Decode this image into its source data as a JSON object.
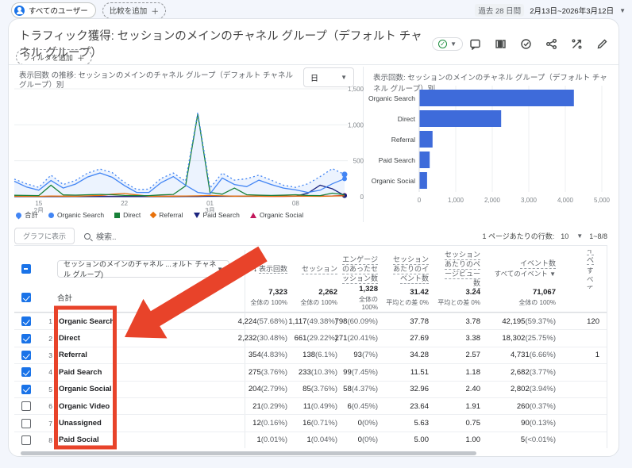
{
  "topbar": {
    "audience_chip": "すべてのユーザー",
    "add_comparison": "比較を追加",
    "date_label": "過去 28 日間",
    "date_range": "2月13日~2026年3月12日"
  },
  "header": {
    "title": "トラフィック獲得: セッションのメインのチャネル グループ（デフォルト チャネル グループ）",
    "filter_chip": "フィルタを追加",
    "icons": [
      "comment",
      "library",
      "insights",
      "share",
      "explore",
      "edit"
    ]
  },
  "panels": {
    "line_title": "表示回数 の推移: セッションのメインのチャネル グループ（デフォルト チャネル グループ）別",
    "granularity": "日",
    "bar_title": "表示回数: セッションのメインのチャネル グループ（デフォルト チャネル グループ）別"
  },
  "colors": {
    "blue": "#4285f4",
    "green": "#188038",
    "orange": "#e8710a",
    "navy": "#1a237e",
    "magenta": "#c2185b",
    "bar_blue": "#3e6bda",
    "annotation": "#e8432a"
  },
  "chart_data": [
    {
      "type": "line",
      "title": "表示回数 の推移",
      "ylim": [
        0,
        1500
      ],
      "yticks": [
        {
          "v": 0,
          "label": "0"
        },
        {
          "v": 500,
          "label": "500"
        },
        {
          "v": 1000,
          "label": "1,000"
        },
        {
          "v": 1500,
          "label": "1,500"
        }
      ],
      "xticks": [
        {
          "index": 2,
          "label": "15\n2月"
        },
        {
          "index": 9,
          "label": "22"
        },
        {
          "index": 16,
          "label": "01\n3月"
        },
        {
          "index": 23,
          "label": "08"
        }
      ],
      "days": 28,
      "series": [
        {
          "name": "合計",
          "color": "#4285f4",
          "style": "dotted",
          "area": true,
          "marker": true,
          "values": [
            245,
            180,
            130,
            300,
            170,
            225,
            330,
            385,
            335,
            200,
            100,
            105,
            255,
            330,
            215,
            1170,
            120,
            330,
            230,
            250,
            300,
            230,
            160,
            130,
            180,
            280,
            390,
            310
          ]
        },
        {
          "name": "Organic Search",
          "color": "#4285f4",
          "style": "solid",
          "marker": true,
          "values": [
            215,
            135,
            90,
            225,
            120,
            175,
            275,
            330,
            270,
            155,
            60,
            60,
            195,
            280,
            160,
            60,
            40,
            260,
            170,
            140,
            230,
            170,
            120,
            95,
            60,
            90,
            180,
            250
          ]
        },
        {
          "name": "Direct",
          "color": "#188038",
          "style": "solid",
          "values": [
            20,
            18,
            15,
            160,
            25,
            22,
            28,
            32,
            28,
            18,
            15,
            15,
            25,
            32,
            150,
            1150,
            60,
            35,
            120,
            28,
            22,
            18,
            22,
            28,
            18,
            15,
            50,
            28
          ]
        },
        {
          "name": "Referral",
          "color": "#e8710a",
          "style": "solid",
          "values": [
            8,
            6,
            5,
            10,
            8,
            6,
            12,
            18,
            35,
            45,
            25,
            8,
            6,
            8,
            10,
            12,
            18,
            12,
            8,
            10,
            8,
            6,
            8,
            10,
            8,
            6,
            10,
            12
          ]
        },
        {
          "name": "Paid Search",
          "color": "#1a237e",
          "style": "solid",
          "marker": true,
          "values": [
            2,
            2,
            2,
            2,
            2,
            2,
            2,
            2,
            2,
            2,
            2,
            2,
            2,
            2,
            3,
            3,
            5,
            5,
            5,
            6,
            8,
            10,
            10,
            8,
            50,
            160,
            110,
            15
          ]
        },
        {
          "name": "Organic Social",
          "color": "#c2185b",
          "style": "solid",
          "marker": true,
          "values": [
            5,
            4,
            4,
            5,
            5,
            7,
            7,
            7,
            5,
            4,
            4,
            4,
            7,
            9,
            7,
            9,
            8,
            7,
            7,
            7,
            5,
            4,
            4,
            7,
            8,
            9,
            11,
            18
          ]
        }
      ],
      "legend": [
        {
          "label": "合計",
          "color": "#4285f4",
          "shape": "pin"
        },
        {
          "label": "Organic Search",
          "color": "#4285f4",
          "shape": "circle"
        },
        {
          "label": "Direct",
          "color": "#188038",
          "shape": "square"
        },
        {
          "label": "Referral",
          "color": "#e8710a",
          "shape": "diamond"
        },
        {
          "label": "Paid Search",
          "color": "#1a237e",
          "shape": "tri-down"
        },
        {
          "label": "Organic Social",
          "color": "#c2185b",
          "shape": "tri-up"
        }
      ]
    },
    {
      "type": "bar",
      "title": "表示回数",
      "categories": [
        "Organic Search",
        "Direct",
        "Referral",
        "Paid Search",
        "Organic Social"
      ],
      "values": [
        4224,
        2232,
        354,
        275,
        204
      ],
      "xlim": [
        0,
        5000
      ],
      "xticks": [
        {
          "v": 0,
          "label": "0"
        },
        {
          "v": 1000,
          "label": "1,000"
        },
        {
          "v": 2000,
          "label": "2,000"
        },
        {
          "v": 3000,
          "label": "3,000"
        },
        {
          "v": 4000,
          "label": "4,000"
        },
        {
          "v": 5000,
          "label": "5,000"
        }
      ]
    }
  ],
  "table": {
    "toolbar": {
      "chart_button": "グラフに表示",
      "search_placeholder": "検索..",
      "rows_label": "1 ページあたりの行数:",
      "rows_value": "10",
      "range": "1~8/8"
    },
    "dimension_selector": "セッションのメインのチャネル ...ォルト チャネル グループ)",
    "columns": [
      {
        "lines": [
          "表示回数"
        ],
        "sorted": true
      },
      {
        "lines": [
          "セッション"
        ]
      },
      {
        "lines": [
          "エンゲージ",
          "のあったセ",
          "ッション数"
        ]
      },
      {
        "lines": [
          "セッション",
          "あたりのイ",
          "ベント数"
        ]
      },
      {
        "lines": [
          "セッション",
          "あたりのペ",
          "ージビュー",
          "数"
        ]
      },
      {
        "lines": [
          "イベント数"
        ],
        "sub": "すべてのイベント",
        "dropdown": true
      },
      {
        "lines": [
          "キーイベ"
        ],
        "sub": "すべてのイ",
        "clipped": true
      }
    ],
    "totals": {
      "label": "合計",
      "cells": [
        {
          "v": "7,323",
          "s": "全体の 100%"
        },
        {
          "v": "2,262",
          "s": "全体の 100%"
        },
        {
          "v": "1,328",
          "s": "全体の 100%"
        },
        {
          "v": "31.42",
          "s": "平均との差 0%"
        },
        {
          "v": "3.24",
          "s": "平均との差 0%"
        },
        {
          "v": "71,067",
          "s": "全体の 100%"
        },
        {
          "v": "",
          "s": ""
        }
      ]
    },
    "rows": [
      {
        "n": "1",
        "checked": true,
        "channel": "Organic Search",
        "cells": [
          "4,224 (57.68%)",
          "1,117 (49.38%)",
          "798 (60.09%)",
          "37.78",
          "3.78",
          "42,195 (59.37%)",
          "120"
        ]
      },
      {
        "n": "2",
        "checked": true,
        "channel": "Direct",
        "cells": [
          "2,232 (30.48%)",
          "661 (29.22%)",
          "271 (20.41%)",
          "27.69",
          "3.38",
          "18,302 (25.75%)",
          ""
        ]
      },
      {
        "n": "3",
        "checked": true,
        "channel": "Referral",
        "cells": [
          "354 (4.83%)",
          "138 (6.1%)",
          "93 (7%)",
          "34.28",
          "2.57",
          "4,731 (6.66%)",
          "1"
        ]
      },
      {
        "n": "4",
        "checked": true,
        "channel": "Paid Search",
        "cells": [
          "275 (3.76%)",
          "233 (10.3%)",
          "99 (7.45%)",
          "11.51",
          "1.18",
          "2,682 (3.77%)",
          ""
        ]
      },
      {
        "n": "5",
        "checked": true,
        "channel": "Organic Social",
        "cells": [
          "204 (2.79%)",
          "85 (3.76%)",
          "58 (4.37%)",
          "32.96",
          "2.40",
          "2,802 (3.94%)",
          ""
        ]
      },
      {
        "n": "6",
        "checked": false,
        "channel": "Organic Video",
        "cells": [
          "21 (0.29%)",
          "11 (0.49%)",
          "6 (0.45%)",
          "23.64",
          "1.91",
          "260 (0.37%)",
          ""
        ]
      },
      {
        "n": "7",
        "checked": false,
        "channel": "Unassigned",
        "cells": [
          "12 (0.16%)",
          "16 (0.71%)",
          "0 (0%)",
          "5.63",
          "0.75",
          "90 (0.13%)",
          ""
        ]
      },
      {
        "n": "8",
        "checked": false,
        "channel": "Paid Social",
        "cells": [
          "1 (0.01%)",
          "1 (0.04%)",
          "0 (0%)",
          "5.00",
          "1.00",
          "5 (<0.01%)",
          ""
        ]
      }
    ]
  }
}
